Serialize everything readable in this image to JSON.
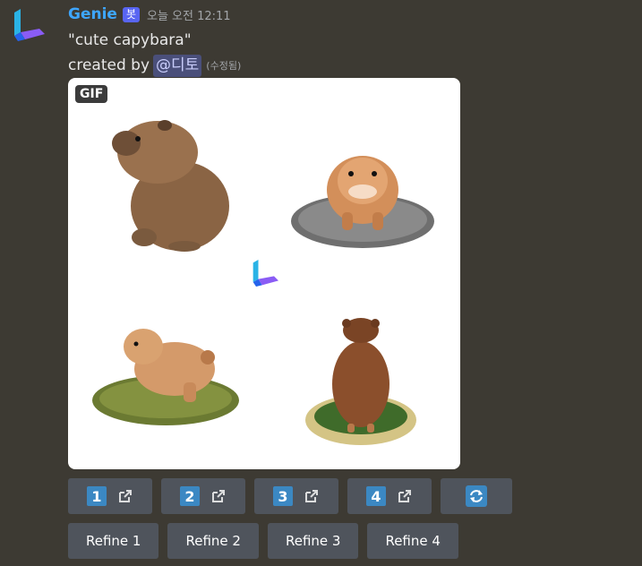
{
  "message": {
    "author": "Genie",
    "bot_badge": "봇",
    "timestamp": "오늘 오전 12:11",
    "prompt": "\"cute capybara\"",
    "created_by": "created by",
    "mention": "@디토",
    "edited": "(수정됨)"
  },
  "image": {
    "gif_label": "GIF"
  },
  "buttons": {
    "numbers": [
      "1",
      "2",
      "3",
      "4"
    ],
    "refine": [
      "Refine 1",
      "Refine 2",
      "Refine 3",
      "Refine 4"
    ]
  },
  "colors": {
    "background": "#3d3a33",
    "username": "#3ea6ff",
    "button": "#4f545c",
    "keycap": "#3b88c3"
  },
  "icons": {
    "avatar": "genie-logo-icon",
    "external": "external-link-icon",
    "reroll": "refresh-icon"
  }
}
